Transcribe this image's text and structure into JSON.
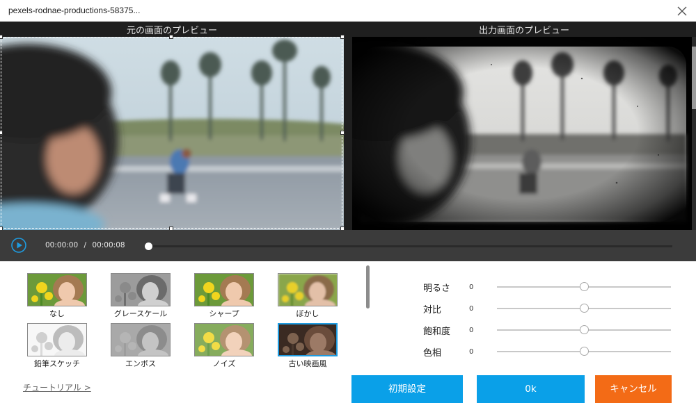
{
  "window": {
    "title": "pexels-rodnae-productions-58375..."
  },
  "preview": {
    "original_label": "元の画面のプレビュー",
    "output_label": "出力画面のプレビュー"
  },
  "player": {
    "current_time": "00:00:00",
    "separator": "/",
    "total_time": "00:00:08",
    "progress": 0
  },
  "filters": [
    {
      "label": "なし",
      "style": "color",
      "selected": false
    },
    {
      "label": "グレースケール",
      "style": "gray",
      "selected": false
    },
    {
      "label": "シャープ",
      "style": "color",
      "selected": false
    },
    {
      "label": "ぼかし",
      "style": "blur",
      "selected": false
    },
    {
      "label": "鉛筆スケッチ",
      "style": "sketch",
      "selected": false
    },
    {
      "label": "エンボス",
      "style": "emboss",
      "selected": false
    },
    {
      "label": "ノイズ",
      "style": "noise",
      "selected": false
    },
    {
      "label": "古い映画風",
      "style": "oldfilm",
      "selected": true
    }
  ],
  "adjustments": [
    {
      "label": "明るさ",
      "value": "0",
      "level": 0.5
    },
    {
      "label": "対比",
      "value": "0",
      "level": 0.5
    },
    {
      "label": "飽和度",
      "value": "0",
      "level": 0.5
    },
    {
      "label": "色相",
      "value": "0",
      "level": 0.5
    }
  ],
  "footer": {
    "tutorial": "チュートリアル >",
    "reset_label": "初期設定",
    "ok_label": "0k",
    "cancel_label": "キャンセル"
  },
  "colors": {
    "accent": "#0aa0e8",
    "cancel": "#f36b16",
    "selected_border": "#1e9be0"
  }
}
